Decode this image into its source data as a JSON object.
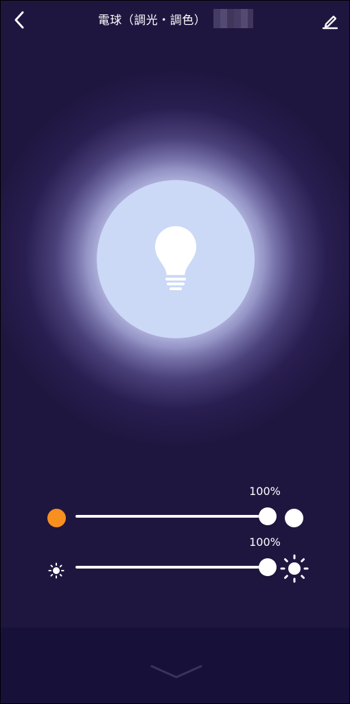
{
  "header": {
    "title": "電球（調光・調色）",
    "back_icon": "chevron-left-icon",
    "edit_icon": "pencil-icon"
  },
  "bulb": {
    "icon": "lightbulb-icon",
    "glow_color": "#cbd9f7"
  },
  "color_temperature": {
    "value_label": "100%",
    "value": 1.0,
    "warm_color": "#f7901e",
    "cool_color": "#ffffff"
  },
  "brightness": {
    "value_label": "100%",
    "value": 1.0,
    "min_icon": "sun-small-icon",
    "max_icon": "sun-large-icon"
  },
  "footer": {
    "collapse_icon": "chevron-down-icon"
  },
  "colors": {
    "background": "#1f1640",
    "bottom_bar": "#17113a"
  }
}
